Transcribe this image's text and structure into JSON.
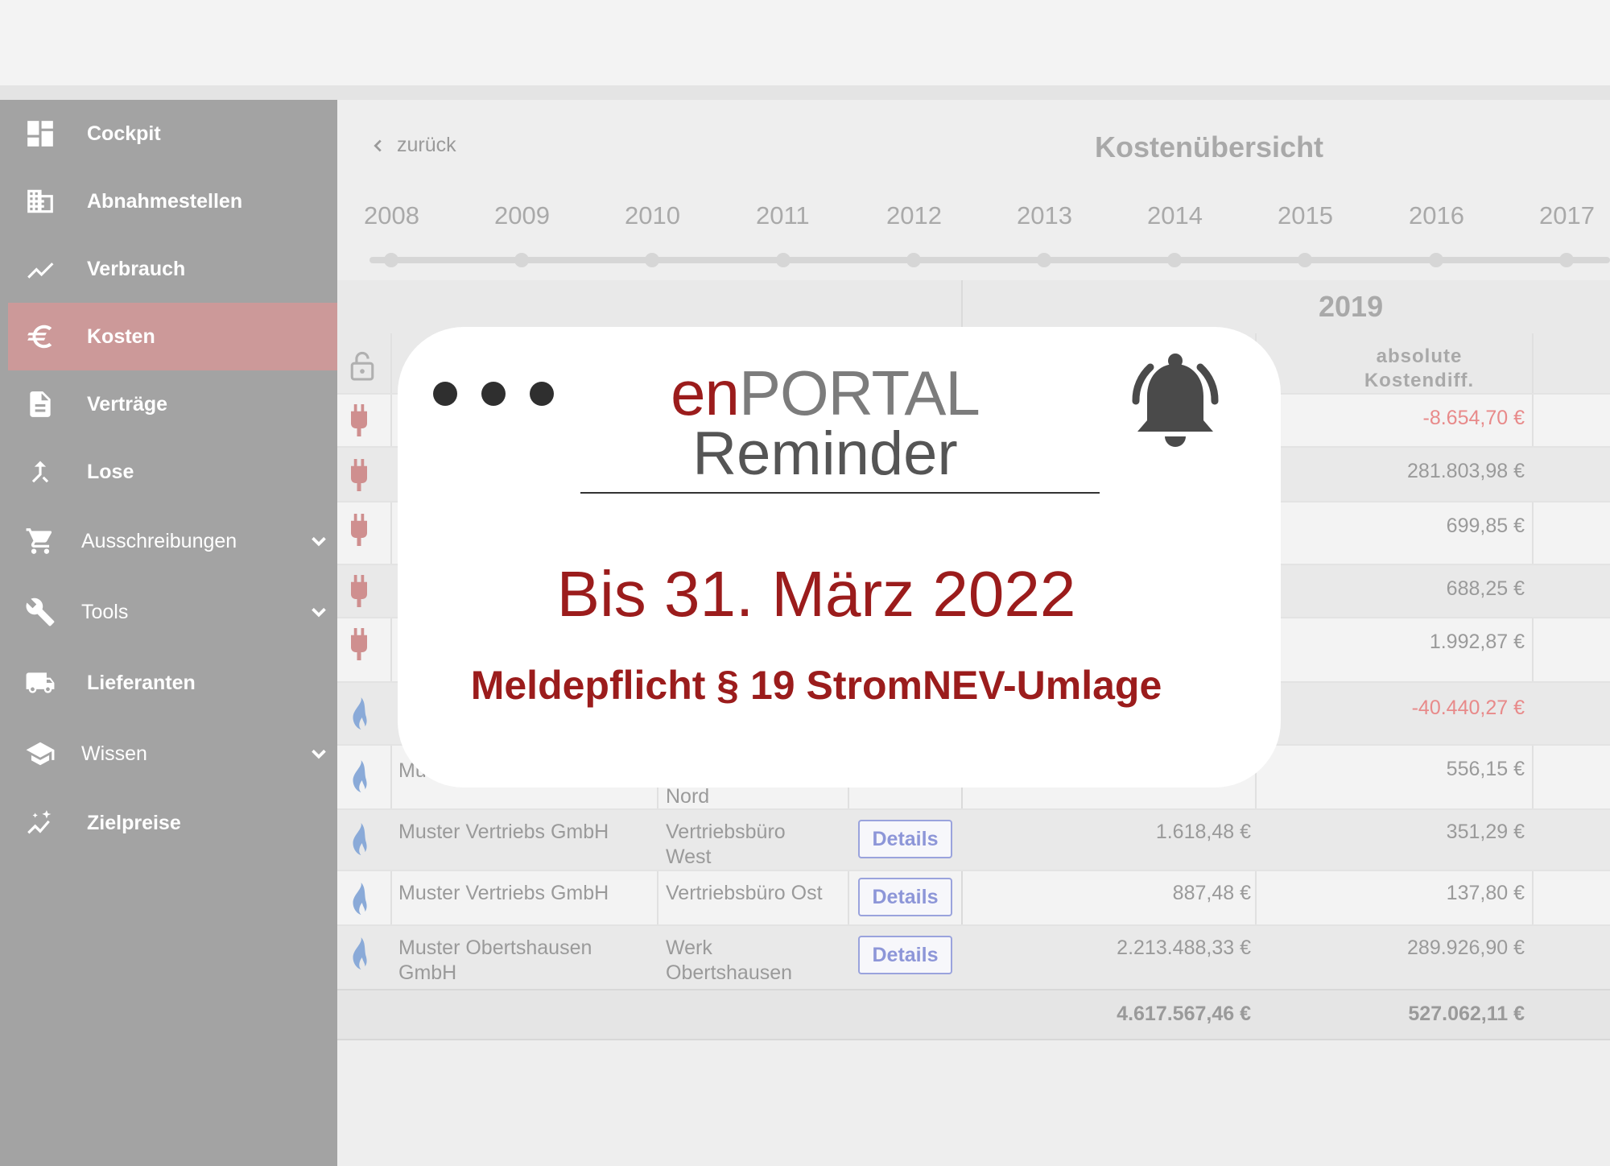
{
  "sidebar": {
    "items": [
      {
        "label": "Cockpit",
        "icon": "dashboard-icon"
      },
      {
        "label": "Abnahmestellen",
        "icon": "building-icon"
      },
      {
        "label": "Verbrauch",
        "icon": "trend-icon"
      },
      {
        "label": "Kosten",
        "icon": "euro-icon",
        "active": true
      },
      {
        "label": "Verträge",
        "icon": "document-icon"
      },
      {
        "label": "Lose",
        "icon": "merge-icon"
      },
      {
        "label": "Ausschreibungen",
        "icon": "cart-icon",
        "expandable": true
      },
      {
        "label": "Tools",
        "icon": "wrench-icon",
        "expandable": true
      },
      {
        "label": "Lieferanten",
        "icon": "truck-icon"
      },
      {
        "label": "Wissen",
        "icon": "graduation-cap-icon",
        "expandable": true
      },
      {
        "label": "Zielpreise",
        "icon": "sparkle-trend-icon"
      }
    ]
  },
  "main": {
    "back_label": "zurück",
    "title": "Kostenübersicht",
    "years": [
      "2008",
      "2009",
      "2010",
      "2011",
      "2012",
      "2013",
      "2014",
      "2015",
      "2016",
      "2017"
    ],
    "selected_year": "2019",
    "column_header": "absolute Kostendiff."
  },
  "table": {
    "details_label": "Details",
    "rows": [
      {
        "type": "strom",
        "diff": "-8.654,70 €",
        "negative": true
      },
      {
        "type": "strom",
        "diff": "281.803,98 €"
      },
      {
        "type": "strom",
        "diff": "699,85 €"
      },
      {
        "type": "strom",
        "diff": "688,25 €"
      },
      {
        "type": "strom",
        "diff": "1.992,87 €"
      },
      {
        "type": "gas",
        "diff": "-40.440,27 €",
        "negative": true
      },
      {
        "type": "gas",
        "company": "Mu",
        "location": "Nord",
        "diff": "556,15 €"
      },
      {
        "type": "gas",
        "company": "Muster Vertriebs GmbH",
        "location": "Vertriebsbüro West",
        "cost": "1.618,48 €",
        "diff": "351,29 €"
      },
      {
        "type": "gas",
        "company": "Muster Vertriebs GmbH",
        "location": "Vertriebsbüro Ost",
        "cost": "887,48 €",
        "diff": "137,80 €"
      },
      {
        "type": "gas",
        "company": "Muster Obertshausen GmbH",
        "location": "Werk Obertshausen",
        "cost": "2.213.488,33 €",
        "diff": "289.926,90 €"
      }
    ],
    "total_cost": "4.617.567,46 €",
    "total_diff": "527.062,11 €"
  },
  "colors": {
    "brand_red": "#9b1c1c",
    "sidebar_bg": "#a3a3a3",
    "sidebar_active": "#cc9999",
    "negative": "#e88a8a",
    "button_border": "#9aa3dd"
  },
  "reminder": {
    "brand_en": "en",
    "brand_portal": "PORTAL",
    "subtitle": "Reminder",
    "headline": "Bis 31. März 2022",
    "subline": "Meldepflicht § 19 StromNEV-Umlage",
    "icon": "bell-icon"
  }
}
